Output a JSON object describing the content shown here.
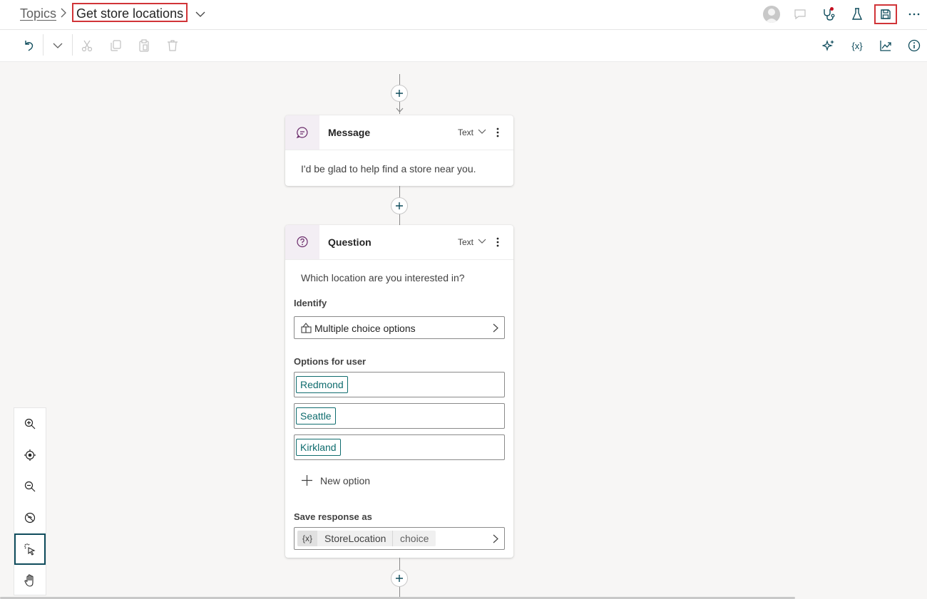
{
  "header": {
    "breadcrumb_root": "Topics",
    "topic_title": "Get store locations",
    "icons": [
      "avatar",
      "comment-icon",
      "topic-checker-icon",
      "test-icon",
      "save-icon",
      "more-icon"
    ]
  },
  "toolbar": {
    "icons": [
      "undo-icon",
      "redo-dropdown-icon",
      "cut-icon",
      "copy-icon",
      "paste-icon",
      "delete-icon",
      "copilot-icon",
      "variables-icon",
      "analytics-icon",
      "details-icon"
    ]
  },
  "message_node": {
    "title": "Message",
    "type": "Text",
    "text": "I'd be glad to help find a store near you."
  },
  "question_node": {
    "title": "Question",
    "type": "Text",
    "prompt": "Which location are you interested in?",
    "identify_label": "Identify",
    "identify_value": "Multiple choice options",
    "options_label": "Options for user",
    "options": [
      "Redmond",
      "Seattle",
      "Kirkland"
    ],
    "new_option": "New option",
    "save_label": "Save response as",
    "variable_badge": "{x}",
    "variable_name": "StoreLocation",
    "variable_type": "choice"
  },
  "zoom_panel": {
    "buttons": [
      "zoom-in-icon",
      "fit-view-icon",
      "zoom-out-icon",
      "minimap-off-icon",
      "select-mode-icon",
      "pan-mode-icon"
    ],
    "active": "select-mode-icon"
  },
  "colors": {
    "accent": "#0f6c6e",
    "highlight": "#d13438",
    "canvas": "#f7f6f5"
  }
}
